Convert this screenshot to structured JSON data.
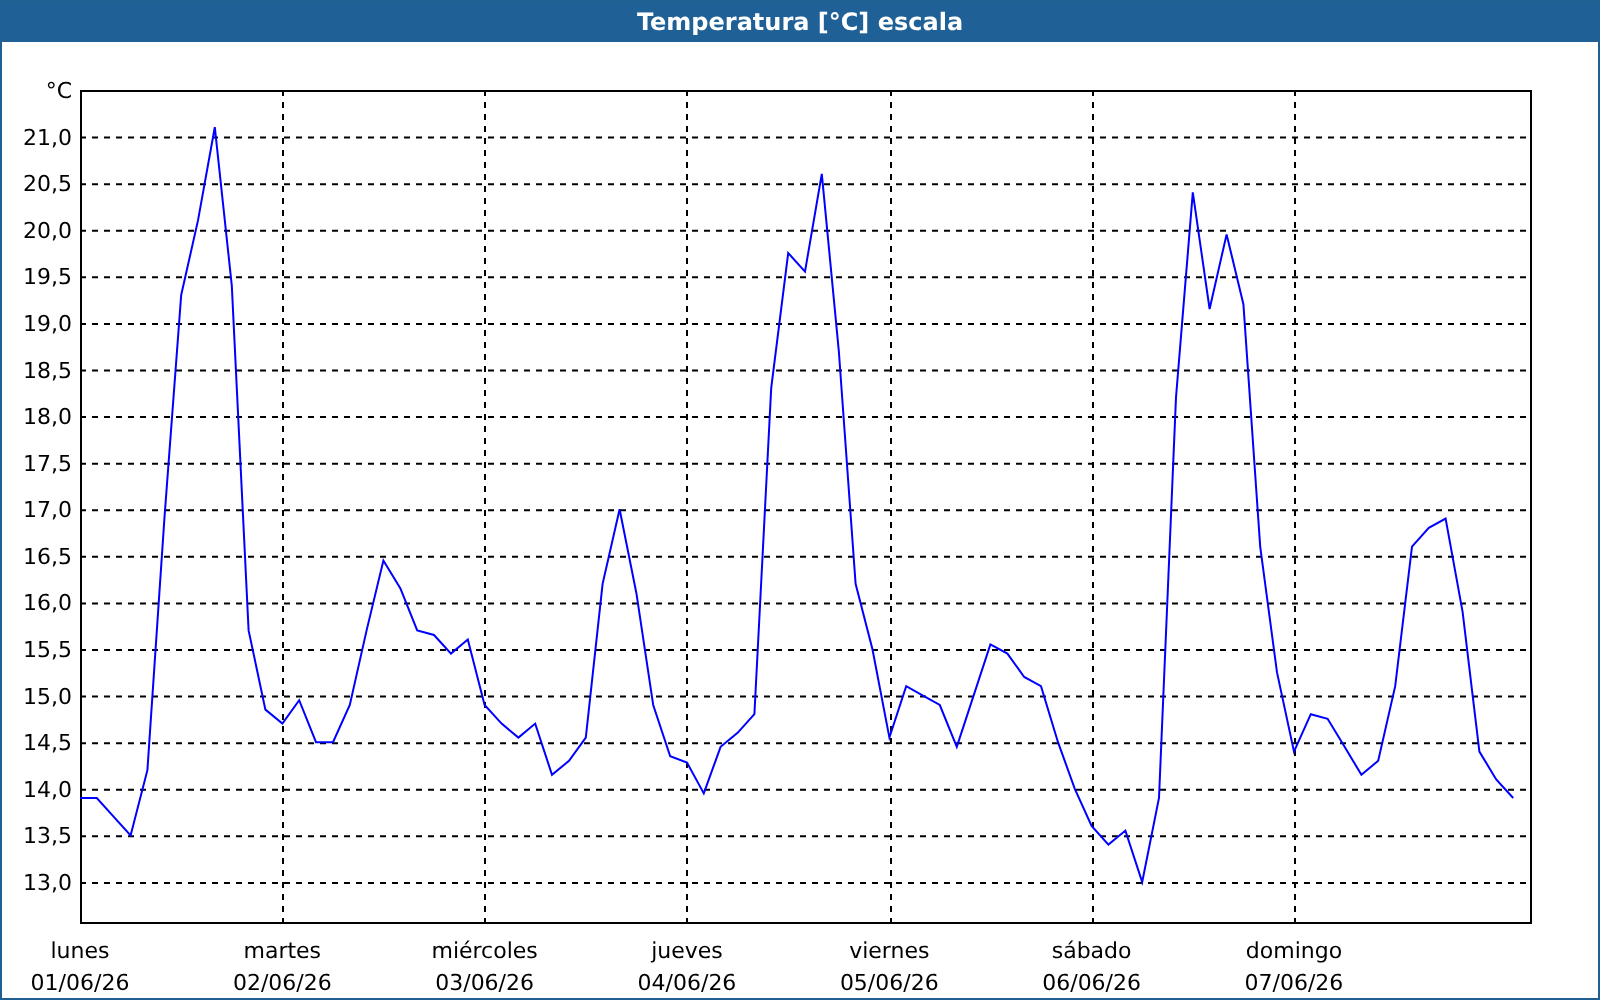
{
  "window": {
    "title": "Temperatura [°C] escala"
  },
  "chart": {
    "chart_data": {
      "type": "line",
      "grid": true,
      "ylabel": "°C",
      "ylim": [
        12.57,
        21.5
      ],
      "yticks": [
        {
          "value": 13,
          "label": "13,0"
        },
        {
          "value": 13.5,
          "label": "13,5"
        },
        {
          "value": 14,
          "label": "14,0"
        },
        {
          "value": 14.5,
          "label": "14,5"
        },
        {
          "value": 15,
          "label": "15,0"
        },
        {
          "value": 15.5,
          "label": "15,5"
        },
        {
          "value": 16,
          "label": "16,0"
        },
        {
          "value": 16.5,
          "label": "16,5"
        },
        {
          "value": 17,
          "label": "17,0"
        },
        {
          "value": 17.5,
          "label": "17,5"
        },
        {
          "value": 18,
          "label": "18,0"
        },
        {
          "value": 18.5,
          "label": "18,5"
        },
        {
          "value": 19,
          "label": "19,0"
        },
        {
          "value": 19.5,
          "label": "19,5"
        },
        {
          "value": 20,
          "label": "20,0"
        },
        {
          "value": 20.5,
          "label": "20,5"
        },
        {
          "value": 21,
          "label": "21,0"
        }
      ],
      "categories": [
        "lunes\n01/06/26",
        null,
        null,
        null,
        null,
        null,
        null,
        null,
        null,
        null,
        null,
        null,
        "martes\n02/06/26",
        null,
        null,
        null,
        null,
        null,
        null,
        null,
        null,
        null,
        null,
        null,
        "miércoles\n03/06/26",
        null,
        null,
        null,
        null,
        null,
        null,
        null,
        null,
        null,
        null,
        null,
        "jueves\n04/06/26",
        null,
        null,
        null,
        null,
        null,
        null,
        null,
        null,
        null,
        null,
        null,
        "viernes\n05/06/26",
        null,
        null,
        null,
        null,
        null,
        null,
        null,
        null,
        null,
        null,
        null,
        "sábado\n06/06/26",
        null,
        null,
        null,
        null,
        null,
        null,
        null,
        null,
        null,
        null,
        null,
        "domingo\n07/06/26",
        null,
        null,
        null,
        null,
        null,
        null,
        null,
        null,
        null,
        null,
        null,
        null,
        null
      ],
      "series": [
        {
          "color": "#0000ff",
          "values": [
            13.9,
            13.9,
            13.7,
            13.5,
            14.2,
            16.9,
            19.3,
            20.1,
            21.1,
            19.4,
            15.7,
            14.85,
            14.7,
            14.95,
            14.5,
            14.5,
            14.9,
            15.7,
            16.45,
            16.15,
            15.7,
            15.65,
            15.45,
            15.6,
            14.9,
            14.7,
            14.55,
            14.7,
            14.15,
            14.3,
            14.55,
            16.2,
            17.0,
            16.1,
            14.9,
            14.35,
            14.28,
            13.95,
            14.45,
            14.6,
            14.8,
            18.3,
            19.75,
            19.55,
            20.6,
            18.7,
            16.2,
            15.5,
            14.55,
            15.1,
            15.0,
            14.9,
            14.45,
            15.0,
            15.55,
            15.45,
            15.2,
            15.1,
            14.5,
            14.0,
            13.6,
            13.4,
            13.55,
            13.0,
            13.9,
            18.2,
            20.4,
            19.15,
            19.95,
            19.2,
            16.6,
            15.25,
            14.4,
            14.8,
            14.75,
            14.45,
            14.15,
            14.3,
            15.1,
            16.6,
            16.8,
            16.9,
            15.9,
            14.4,
            14.1,
            13.9
          ]
        }
      ]
    }
  }
}
